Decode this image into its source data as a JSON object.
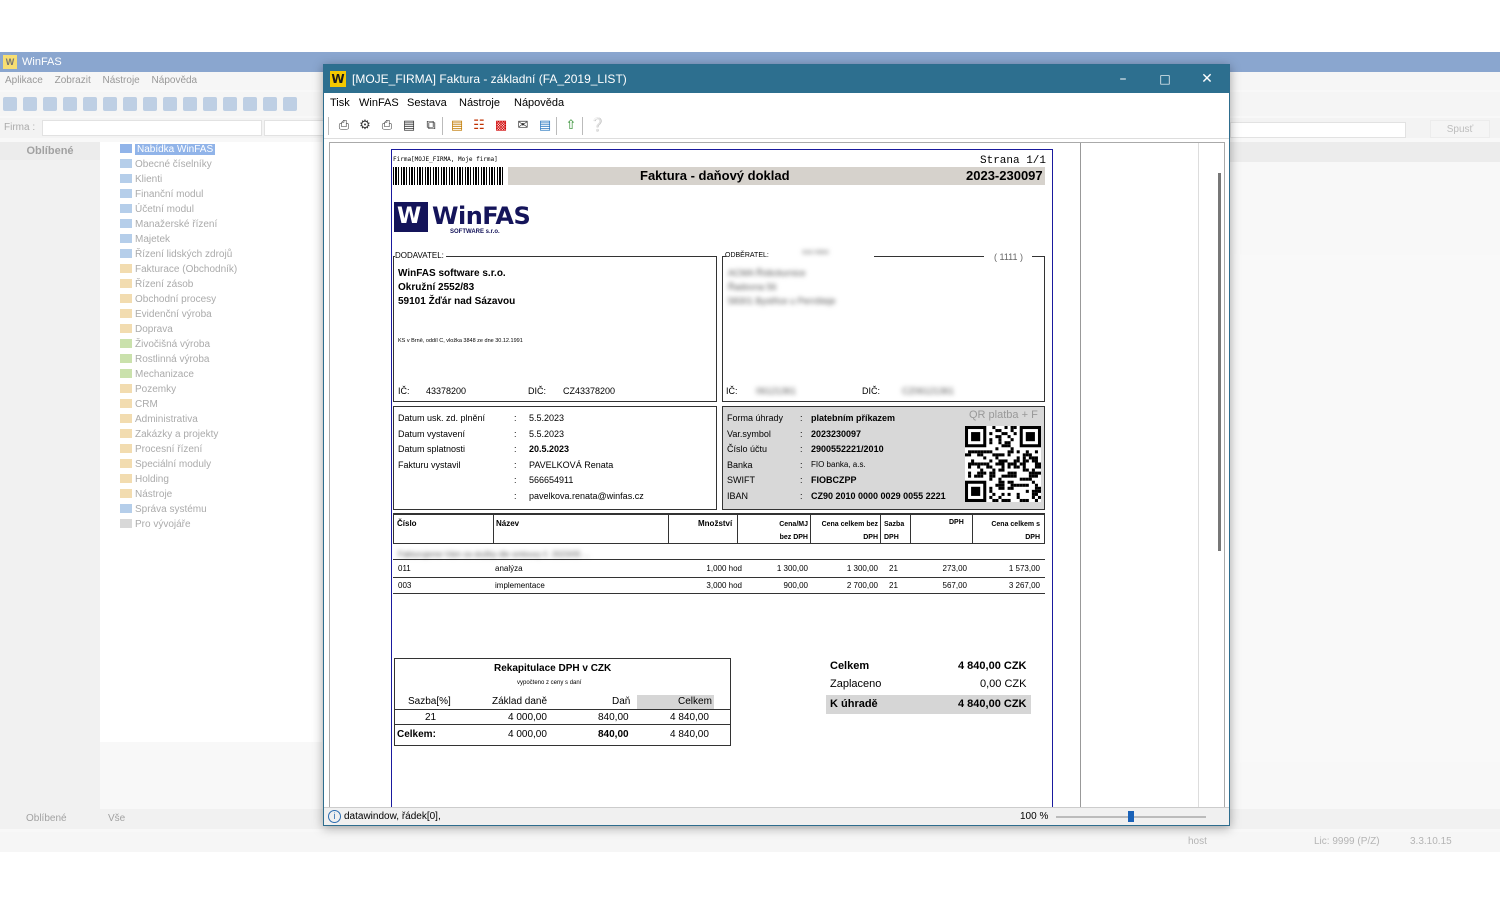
{
  "background_app": {
    "title": "WinFAS",
    "menu": [
      "Aplikace",
      "Zobrazit",
      "Nástroje",
      "Nápověda"
    ],
    "firma_label": "Firma :",
    "left_header": "Oblíbené",
    "tree_root": "Nabídka WinFAS",
    "tree_items": [
      "Obecné číselníky",
      "Klienti",
      "Finanční modul",
      "Účetní modul",
      "Manažerské řízení",
      "Majetek",
      "Řízení lidských zdrojů",
      "Fakturace (Obchodník)",
      "Řízení zásob",
      "Obchodní procesy",
      "Evidenční výroba",
      "Doprava",
      "Živočišná výroba",
      "Rostlinná výroba",
      "Mechanizace",
      "Pozemky",
      "CRM",
      "Administrativa",
      "Zakázky a projekty",
      "Procesní řízení",
      "Speciální moduly",
      "Holding",
      "Nástroje",
      "Správa systému",
      "Pro vývojáře"
    ],
    "run_button": "Spusť",
    "bottom_tabs": [
      "Oblíbené",
      "Vše"
    ],
    "status_user": "host",
    "status_lic": "Lic: 9999 (P/Z)",
    "status_version": "3.3.10.15"
  },
  "window": {
    "title": "[MOJE_FIRMA] Faktura - základní (FA_2019_LIST)",
    "menu": [
      "Tisk",
      "WinFAS",
      "Sestava",
      "Nástroje",
      "Nápověda"
    ],
    "status_text": "datawindow, řádek[0],",
    "zoom": "100 %",
    "zoom_value": 0.5
  },
  "invoice": {
    "firm_line": "Firma[MOJE_FIRMA, Moje firma]",
    "page_label": "Strana 1/1",
    "doc_title": "Faktura - daňový doklad",
    "doc_number": "2023-230097",
    "logo_text": "WinFAS",
    "logo_sub": "SOFTWARE s.r.o.",
    "supplier": {
      "label": "DODAVATEL:",
      "name": "WinFAS software s.r.o.",
      "street": "Okružní 2552/83",
      "city": "59101 Žďár nad Sázavou",
      "registry": "KS v Brně, oddíl C, vložka 3848 ze dne 30.12.1991",
      "ic_label": "IČ:",
      "ic": "43378200",
      "dic_label": "DIČ:",
      "dic": "CZ43378200"
    },
    "customer": {
      "label": "ODBĚRATEL:",
      "code": "43474964",
      "id": "( 1111 )",
      "name": "ACMA Řídiciturnice",
      "street": "Řadovna 56",
      "city": "58301 Bystřice u Pernšteje",
      "ic_label": "IČ:",
      "ic": "06121361",
      "dic_label": "DIČ:",
      "dic": "CZ06121361"
    },
    "dates": [
      {
        "label": "Datum usk. zd. plnění",
        "value": "5.5.2023",
        "bold": false
      },
      {
        "label": "Datum vystavení",
        "value": "5.5.2023",
        "bold": false
      },
      {
        "label": "Datum splatnosti",
        "value": "20.5.2023",
        "bold": true
      },
      {
        "label": "Fakturu vystavil",
        "value": "PAVELKOVÁ Renata",
        "bold": false
      },
      {
        "label": "",
        "value": "566654911",
        "bold": false
      },
      {
        "label": "",
        "value": "pavelkova.renata@winfas.cz",
        "bold": false
      }
    ],
    "payment": [
      {
        "label": "Forma úhrady",
        "value": "platebním příkazem",
        "bold": true
      },
      {
        "label": "Var.symbol",
        "value": "2023230097",
        "bold": true
      },
      {
        "label": "Číslo účtu",
        "value": "2900552221/2010",
        "bold": true
      },
      {
        "label": "Banka",
        "value": "FIO banka, a.s.",
        "bold": false
      },
      {
        "label": "SWIFT",
        "value": "FIOBCZPP",
        "bold": true
      },
      {
        "label": "IBAN",
        "value": "CZ90 2010 0000 0029 0055 2221",
        "bold": true
      }
    ],
    "qr_label": "QR platba + F",
    "items_header": [
      "Číslo",
      "Název",
      "Množství",
      "Cena/MJ bez DPH",
      "Cena celkem bez DPH",
      "Sazba DPH",
      "DPH",
      "Cena celkem s DPH"
    ],
    "items_note": "Fakturujeme Vám za služby dle smlouvy č. 2023/05 ...",
    "items": [
      {
        "cislo": "011",
        "nazev": "analýza",
        "mnozstvi": "1,000 hod",
        "cena_mj": "1 300,00",
        "cena_bez": "1 300,00",
        "sazba": "21",
        "dph": "273,00",
        "cena_s": "1 573,00"
      },
      {
        "cislo": "003",
        "nazev": "implementace",
        "mnozstvi": "3,000 hod",
        "cena_mj": "900,00",
        "cena_bez": "2 700,00",
        "sazba": "21",
        "dph": "567,00",
        "cena_s": "3 267,00"
      }
    ],
    "recap": {
      "title": "Rekapitulace DPH v CZK",
      "subtitle": "vypočteno z ceny s daní",
      "headers": [
        "Sazba[%]",
        "Základ daně",
        "Daň",
        "Celkem"
      ],
      "rows": [
        {
          "sazba": "21",
          "zaklad": "4 000,00",
          "dan": "840,00",
          "celkem": "4 840,00"
        }
      ],
      "total_label": "Celkem:",
      "total_zaklad": "4 000,00",
      "total_dan": "840,00",
      "total_celkem": "4 840,00"
    },
    "totals": [
      {
        "label": "Celkem",
        "value": "4 840,00 CZK",
        "bold": true
      },
      {
        "label": "Zaplaceno",
        "value": "0,00 CZK",
        "bold": false
      },
      {
        "label": "K úhradě",
        "value": "4 840,00 CZK",
        "bold": true
      }
    ]
  }
}
